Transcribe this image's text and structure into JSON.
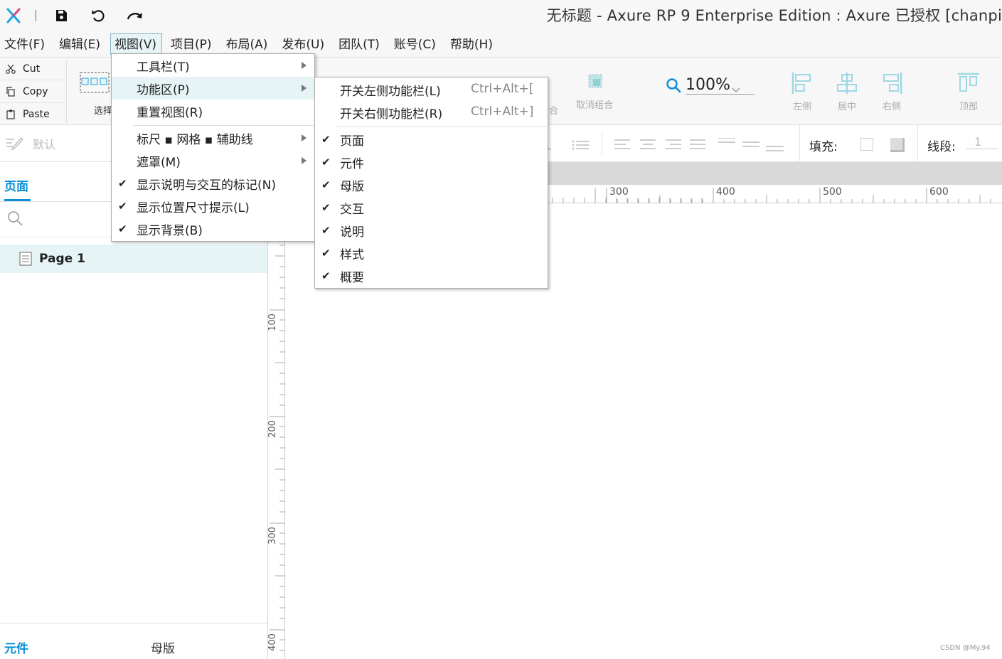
{
  "window": {
    "title": "无标题 - Axure RP 9 Enterprise Edition : Axure 已授权    [chanpi"
  },
  "menubar": {
    "items": [
      "文件(F)",
      "编辑(E)",
      "视图(V)",
      "项目(P)",
      "布局(A)",
      "发布(U)",
      "团队(T)",
      "账号(C)",
      "帮助(H)"
    ]
  },
  "toolbar": {
    "cut": "Cut",
    "copy": "Copy",
    "paste": "Paste",
    "select_partial": "选择",
    "ungroup": "取消组合",
    "group_partial": "合",
    "zoom": "100%",
    "align_left": "左侧",
    "align_center": "居中",
    "align_right": "右侧",
    "align_top": "顶部"
  },
  "formatbar": {
    "style_default": "默认",
    "fill_label": "填充:",
    "line_label": "线段:",
    "line_value": "1"
  },
  "left_panel": {
    "pages_tab": "页面",
    "pages": [
      "Page 1"
    ],
    "bottom_tabs": [
      "元件",
      "母版"
    ]
  },
  "ruler": {
    "top_labels": [
      "300",
      "400",
      "500",
      "600"
    ],
    "left_labels": [
      "100",
      "200",
      "300",
      "400"
    ]
  },
  "view_menu": {
    "items": [
      {
        "label": "工具栏(T)",
        "submenu": true,
        "checked": false
      },
      {
        "label": "功能区(P)",
        "submenu": true,
        "checked": false,
        "highlighted": true
      },
      {
        "label": "重置视图(R)",
        "submenu": false,
        "checked": false
      },
      {
        "label": "标尺 ▪ 网格 ▪ 辅助线",
        "submenu": true,
        "checked": false
      },
      {
        "label": "遮罩(M)",
        "submenu": true,
        "checked": false
      },
      {
        "label": "显示说明与交互的标记(N)",
        "submenu": false,
        "checked": true
      },
      {
        "label": "显示位置尺寸提示(L)",
        "submenu": false,
        "checked": true
      },
      {
        "label": "显示背景(B)",
        "submenu": false,
        "checked": true
      }
    ]
  },
  "pane_submenu": {
    "items": [
      {
        "label": "开关左侧功能栏(L)",
        "shortcut": "Ctrl+Alt+[",
        "checked": false
      },
      {
        "label": "开关右侧功能栏(R)",
        "shortcut": "Ctrl+Alt+]",
        "checked": false
      },
      {
        "label": "页面",
        "checked": true
      },
      {
        "label": "元件",
        "checked": true
      },
      {
        "label": "母版",
        "checked": true
      },
      {
        "label": "交互",
        "checked": true
      },
      {
        "label": "说明",
        "checked": true
      },
      {
        "label": "样式",
        "checked": true
      },
      {
        "label": "概要",
        "checked": true
      }
    ]
  },
  "watermark": "CSDN @My.94",
  "colors": {
    "accent": "#0a8fd8",
    "brand_x_blue": "#1aa6e0",
    "brand_x_pink": "#e0457b",
    "menu_highlight": "#e6f4f6",
    "selected_row": "#e6f4f6"
  }
}
